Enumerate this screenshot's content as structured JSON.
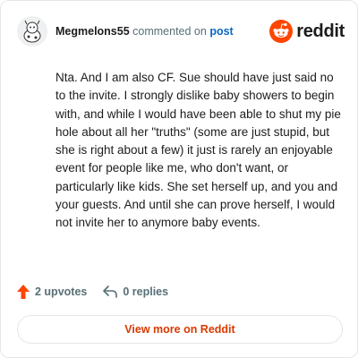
{
  "header": {
    "author": "Megmelons55",
    "verb": "commented on",
    "post_link": "post",
    "brand": "reddit"
  },
  "comment": {
    "text": "Nta. And I am also CF. Sue should have just said no to the invite. I strongly dislike baby showers to begin with, and while I would have been able to shut my pie hole about all her \"truths\" (some are just stupid, but she is right about a few) it just is rarely an enjoyable event for people like me, who don't want, or particularly like kids. She set herself up, and you and your guests. And until she can prove herself, I would not invite her to anymore baby events."
  },
  "actions": {
    "upvotes": "2 upvotes",
    "replies": "0 replies"
  },
  "footer": {
    "view_button": "View more on Reddit"
  },
  "colors": {
    "brand_orange": "#ff4500",
    "link_blue": "#0a66c2",
    "button_text": "#d93900",
    "muted": "#576f76"
  },
  "icons": [
    "avatar-icon",
    "reddit-logo-icon",
    "upvote-arrow-icon",
    "reply-icon"
  ]
}
